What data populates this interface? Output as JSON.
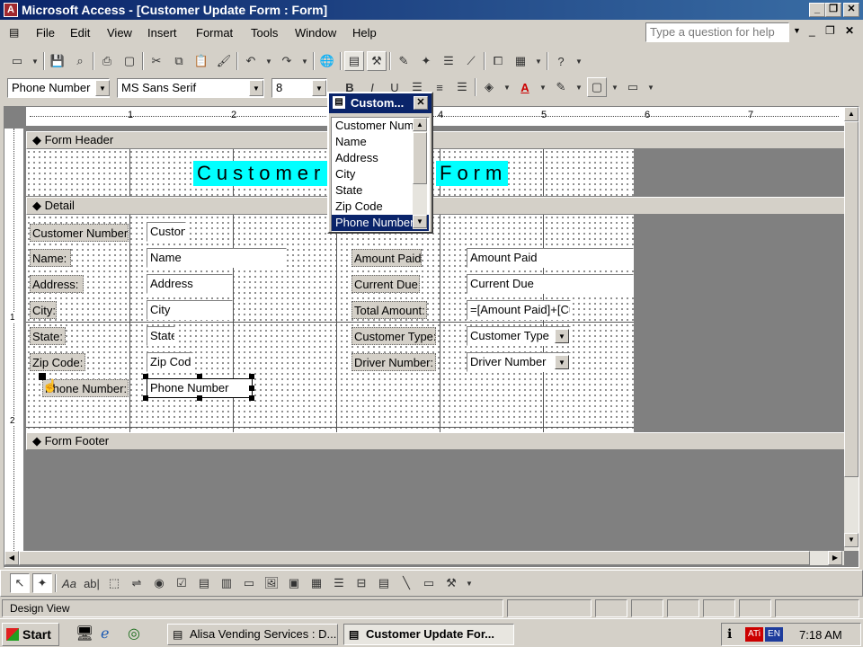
{
  "window": {
    "title": "Microsoft Access - [Customer Update Form : Form]",
    "app_icon": "A"
  },
  "menu": {
    "items": [
      "File",
      "Edit",
      "View",
      "Insert",
      "Format",
      "Tools",
      "Window",
      "Help"
    ],
    "help_placeholder": "Type a question for help"
  },
  "format_toolbar": {
    "object": "Phone Number",
    "font": "MS Sans Serif",
    "size": "8"
  },
  "ruler": {
    "marks": [
      "1",
      "2",
      "3",
      "4",
      "5",
      "6",
      "7"
    ],
    "left_marks": [
      "1",
      "2"
    ]
  },
  "form": {
    "header_label": "Form Header",
    "detail_label": "Detail",
    "footer_label": "Form Footer",
    "title_part1": "Customer",
    "title_part2": "Form",
    "fields_left": [
      {
        "label": "Customer Number:",
        "value": "Custon"
      },
      {
        "label": "Name:",
        "value": "Name"
      },
      {
        "label": "Address:",
        "value": "Address"
      },
      {
        "label": "City:",
        "value": "City"
      },
      {
        "label": "State:",
        "value": "State"
      },
      {
        "label": "Zip Code:",
        "value": "Zip Cod"
      },
      {
        "label": "Phone Number:",
        "value": "Phone Number"
      }
    ],
    "fields_right": [
      {
        "label": "Amount Paid:",
        "value": "Amount Paid"
      },
      {
        "label": "Current Due:",
        "value": "Current Due"
      },
      {
        "label": "Total Amount:",
        "value": "=[Amount Paid]+[Cu"
      },
      {
        "label": "Customer Type:",
        "value": "Customer Type"
      },
      {
        "label": "Driver Number:",
        "value": "Driver Number"
      }
    ]
  },
  "field_list": {
    "title": "Custom...",
    "items": [
      "Customer Num",
      "Name",
      "Address",
      "City",
      "State",
      "Zip Code",
      "Phone Number"
    ],
    "selected": "Phone Number"
  },
  "status": {
    "text": "Design View"
  },
  "taskbar": {
    "start": "Start",
    "tasks": [
      "Alisa Vending Services : D...",
      "Customer Update For..."
    ],
    "lang": "EN",
    "clock": "7:18 AM"
  },
  "colors": {
    "titlebar": "#0a246a",
    "form_title_bg": "#00ffff",
    "selected": "#0a246a"
  }
}
